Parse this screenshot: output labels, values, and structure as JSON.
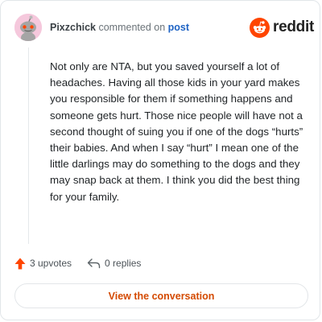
{
  "comment": {
    "username": "Pixzchick",
    "action_text": "commented on",
    "post_link_label": "post",
    "body": "Not only are NTA, but you saved yourself a lot of headaches. Having all those kids in your yard makes you responsible for them if something happens and someone gets hurt. Those nice people will have not a second thought of suing you if one of the dogs “hurts” their babies. And when I say “hurt” I mean one of the little darlings may do something to the dogs and they may snap back at them. I think you did the best thing for your family."
  },
  "brand": {
    "wordmark": "reddit",
    "icon": "reddit-snoo-icon",
    "accent_color": "#ff4500"
  },
  "actions": {
    "upvotes_label": "3 upvotes",
    "upvote_icon": "upvote-arrow-icon",
    "replies_label": "0 replies",
    "reply_icon": "reply-arrow-icon"
  },
  "footer": {
    "button_label": "View the conversation"
  },
  "colors": {
    "username": "#3b4146",
    "post_link": "#1e63c4",
    "upvote": "#ff4500",
    "button_text": "#d44a00"
  }
}
